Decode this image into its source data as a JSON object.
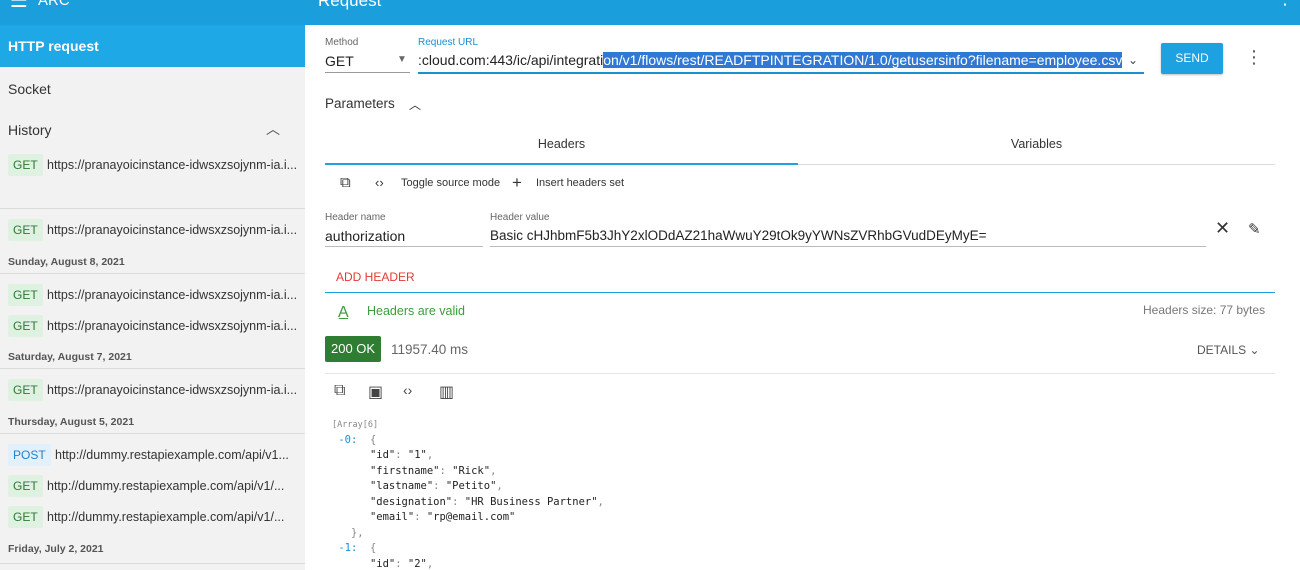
{
  "app": {
    "name": "ARC",
    "title": "Request"
  },
  "sidebar": {
    "active_item": "HTTP request",
    "socket": "Socket",
    "history": "History",
    "groups": [
      {
        "date": "",
        "items": [
          {
            "method": "GET",
            "url": "https://pranayoicinstance-idwsxzsojynm-ia.i..."
          }
        ]
      },
      {
        "date": "",
        "items": [
          {
            "method": "GET",
            "url": "https://pranayoicinstance-idwsxzsojynm-ia.i..."
          }
        ]
      },
      {
        "date": "Sunday, August 8, 2021",
        "items": [
          {
            "method": "GET",
            "url": "https://pranayoicinstance-idwsxzsojynm-ia.i..."
          },
          {
            "method": "GET",
            "url": "https://pranayoicinstance-idwsxzsojynm-ia.i..."
          }
        ]
      },
      {
        "date": "Saturday, August 7, 2021",
        "items": [
          {
            "method": "GET",
            "url": "https://pranayoicinstance-idwsxzsojynm-ia.i..."
          }
        ]
      },
      {
        "date": "Thursday, August 5, 2021",
        "items": [
          {
            "method": "POST",
            "url": "http://dummy.restapiexample.com/api/v1..."
          },
          {
            "method": "GET",
            "url": "http://dummy.restapiexample.com/api/v1/..."
          },
          {
            "method": "GET",
            "url": "http://dummy.restapiexample.com/api/v1/..."
          }
        ]
      },
      {
        "date": "Friday, July 2, 2021",
        "items": []
      }
    ]
  },
  "request": {
    "method_label": "Method",
    "method": "GET",
    "url_label": "Request URL",
    "url_prefix": ":cloud.com:443/ic/api/integrati",
    "url_selected": "on/v1/flows/rest/READFTPINTEGRATION/1.0/getusersinfo?filename=employee.csv",
    "send_label": "SEND"
  },
  "parameters": {
    "title": "Parameters",
    "tabs": [
      "Headers",
      "Variables"
    ],
    "toolbar": {
      "toggle_source": "Toggle source mode",
      "insert_headers": "Insert headers set"
    },
    "header_name_label": "Header name",
    "header_name": "authorization",
    "header_value_label": "Header value",
    "header_value": "Basic cHJhbmF5b3JhY2xlODdAZ21haWwuY29tOk9yYWNsZVRhbGVudDEyMyE=",
    "add_header": "ADD HEADER",
    "valid_text": "Headers are valid",
    "headers_size": "Headers size: 77 bytes"
  },
  "response": {
    "status": "200 OK",
    "time": "11957.40 ms",
    "details": "DETAILS",
    "json_lines": [
      {
        "indent": "",
        "parts": [
          [
            "arr",
            "[Array[6]"
          ]
        ]
      },
      {
        "indent": " ",
        "parts": [
          [
            "idx",
            "-0: "
          ],
          [
            "punc",
            " {"
          ]
        ]
      },
      {
        "indent": "      ",
        "parts": [
          [
            "key",
            "\"id\""
          ],
          [
            "punc",
            ": "
          ],
          [
            "str",
            "\"1\""
          ],
          [
            "punc",
            ","
          ]
        ]
      },
      {
        "indent": "      ",
        "parts": [
          [
            "key",
            "\"firstname\""
          ],
          [
            "punc",
            ": "
          ],
          [
            "str",
            "\"Rick\""
          ],
          [
            "punc",
            ","
          ]
        ]
      },
      {
        "indent": "      ",
        "parts": [
          [
            "key",
            "\"lastname\""
          ],
          [
            "punc",
            ": "
          ],
          [
            "str",
            "\"Petito\""
          ],
          [
            "punc",
            ","
          ]
        ]
      },
      {
        "indent": "      ",
        "parts": [
          [
            "key",
            "\"designation\""
          ],
          [
            "punc",
            ": "
          ],
          [
            "str",
            "\"HR Business Partner\""
          ],
          [
            "punc",
            ","
          ]
        ]
      },
      {
        "indent": "      ",
        "parts": [
          [
            "key",
            "\"email\""
          ],
          [
            "punc",
            ": "
          ],
          [
            "str",
            "\"rp@email.com\""
          ]
        ]
      },
      {
        "indent": "   ",
        "parts": [
          [
            "punc",
            "},"
          ]
        ]
      },
      {
        "indent": " ",
        "parts": [
          [
            "idx",
            "-1: "
          ],
          [
            "punc",
            " {"
          ]
        ]
      },
      {
        "indent": "      ",
        "parts": [
          [
            "key",
            "\"id\""
          ],
          [
            "punc",
            ": "
          ],
          [
            "str",
            "\"2\""
          ],
          [
            "punc",
            ","
          ]
        ]
      }
    ]
  },
  "colors": {
    "brand": "#1a9fdc",
    "active": "#1ea8e6",
    "success": "#2e7d32",
    "danger": "#e53935"
  }
}
